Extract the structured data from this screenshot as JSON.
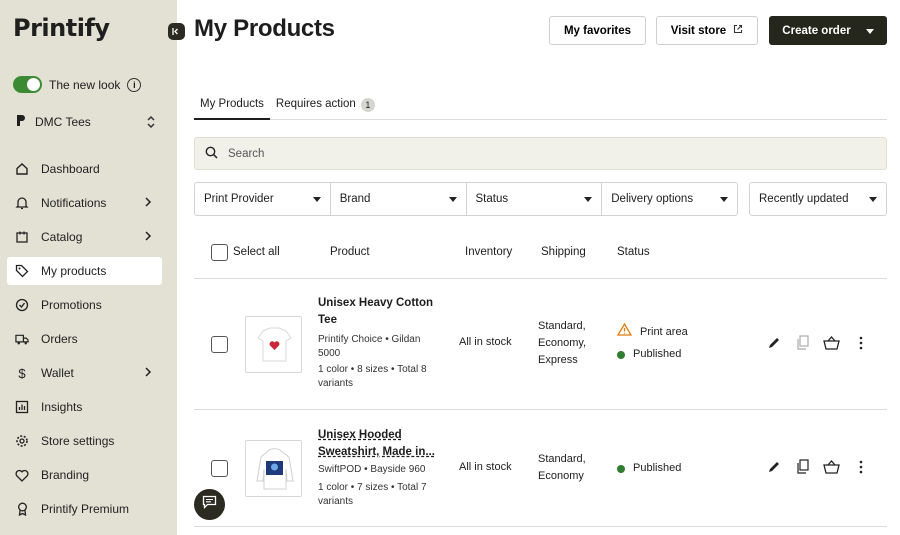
{
  "app": {
    "logo": "Printify"
  },
  "sidebar": {
    "new_look_label": "The new look",
    "store_name": "DMC Tees",
    "items": [
      {
        "label": "Dashboard",
        "icon": "home-icon",
        "chevron": false,
        "active": false
      },
      {
        "label": "Notifications",
        "icon": "bell-icon",
        "chevron": true,
        "active": false
      },
      {
        "label": "Catalog",
        "icon": "catalog-icon",
        "chevron": true,
        "active": false
      },
      {
        "label": "My products",
        "icon": "tag-icon",
        "chevron": false,
        "active": true
      },
      {
        "label": "Promotions",
        "icon": "promotion-badge-icon",
        "chevron": false,
        "active": false
      },
      {
        "label": "Orders",
        "icon": "truck-icon",
        "chevron": false,
        "active": false
      },
      {
        "label": "Wallet",
        "icon": "dollar-icon",
        "chevron": true,
        "active": false
      },
      {
        "label": "Insights",
        "icon": "chart-icon",
        "chevron": false,
        "active": false
      },
      {
        "label": "Store settings",
        "icon": "gear-icon",
        "chevron": false,
        "active": false
      },
      {
        "label": "Branding",
        "icon": "heart-icon",
        "chevron": false,
        "active": false
      },
      {
        "label": "Printify Premium",
        "icon": "medal-icon",
        "chevron": false,
        "active": false
      }
    ]
  },
  "header": {
    "title": "My Products",
    "favorites_label": "My favorites",
    "visit_label": "Visit store",
    "create_label": "Create order"
  },
  "tabs": [
    {
      "label": "My Products",
      "badge": ""
    },
    {
      "label": "Requires action",
      "badge": "1"
    }
  ],
  "search": {
    "placeholder": "Search"
  },
  "filters": [
    "Print Provider",
    "Brand",
    "Status",
    "Delivery options"
  ],
  "sort": {
    "selected": "Recently updated"
  },
  "table": {
    "select_all": "Select all",
    "columns": {
      "product": "Product",
      "inventory": "Inventory",
      "shipping": "Shipping",
      "status": "Status"
    },
    "rows": [
      {
        "name": "Unisex Heavy Cotton Tee",
        "provider": "Printify Choice • Gildan 5000",
        "variants": "1 color • 8 sizes • Total 8 variants",
        "inventory": "All in stock",
        "shipping": "Standard, Economy, Express",
        "warning": "Print area",
        "status": "Published"
      },
      {
        "name": "Unisex Hooded Sweatshirt, Made in...",
        "provider": "SwiftPOD • Bayside 960",
        "variants": "1 color • 7 sizes • Total 7 variants",
        "inventory": "All in stock",
        "shipping": "Standard, Economy",
        "warning": "",
        "status": "Published"
      }
    ]
  },
  "colors": {
    "sidebar_bg": "#e3e1d4",
    "accent_dark": "#25261c",
    "toggle_green": "#3d8a34",
    "published_green": "#2f7d31",
    "warning_orange": "#e07b12"
  }
}
